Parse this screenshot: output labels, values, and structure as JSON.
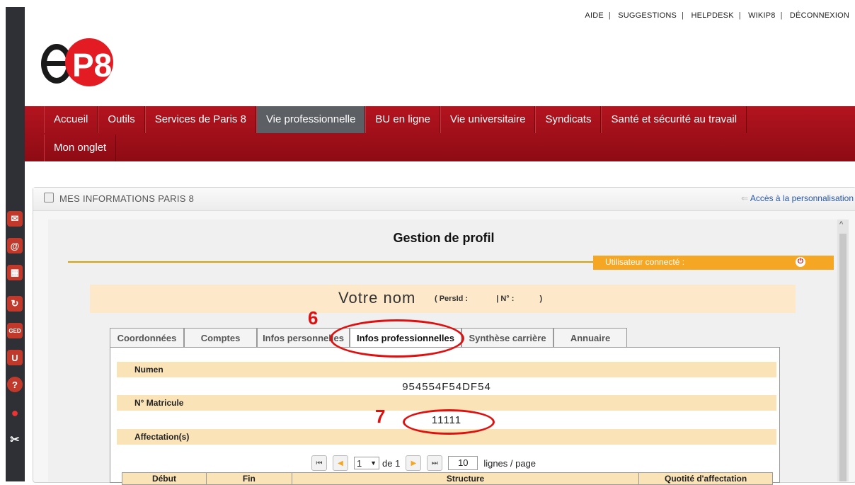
{
  "top_links": [
    "AIDE",
    "SUGGESTIONS",
    "HELPDESK",
    "WIKIP8",
    "DÉCONNEXION"
  ],
  "logo_text": "ep8",
  "menu": {
    "row1": [
      "Accueil",
      "Outils",
      "Services de Paris 8",
      "Vie professionnelle",
      "BU en ligne",
      "Vie universitaire",
      "Syndicats",
      "Santé et sécurité au travail"
    ],
    "row2": [
      "Mon onglet"
    ],
    "active": "Vie professionnelle"
  },
  "portlet": {
    "title": "MES INFORMATIONS PARIS 8",
    "link": "Accès à la personnalisation"
  },
  "profile": {
    "title": "Gestion de profil",
    "user_label": "Utilisateur connecté :",
    "name": "Votre nom",
    "persid_label": "( PersId :",
    "num_label": "| N° :",
    "close_paren": ")"
  },
  "tabs": [
    "Coordonnées",
    "Comptes",
    "Infos personnelles",
    "Infos professionnelles",
    "Synthèse carrière",
    "Annuaire"
  ],
  "active_tab": "Infos professionnelles",
  "fields": {
    "numen_label": "Numen",
    "numen_value": "954554F54DF54",
    "matricule_label": "N° Matricule",
    "matricule_value": "11111",
    "affectation_label": "Affectation(s)"
  },
  "pager": {
    "page": "1",
    "of_label": "de 1",
    "lines": "10",
    "lines_label": "lignes / page"
  },
  "table_headers": [
    "Début",
    "Fin",
    "Structure",
    "Quotité d'affectation"
  ],
  "annotations": [
    "6",
    "7"
  ],
  "colors": {
    "menu_red": "#a0101a",
    "accent_orange": "#f5a623",
    "annotation_red": "#e01010",
    "section_beige": "#fbe3b8"
  }
}
